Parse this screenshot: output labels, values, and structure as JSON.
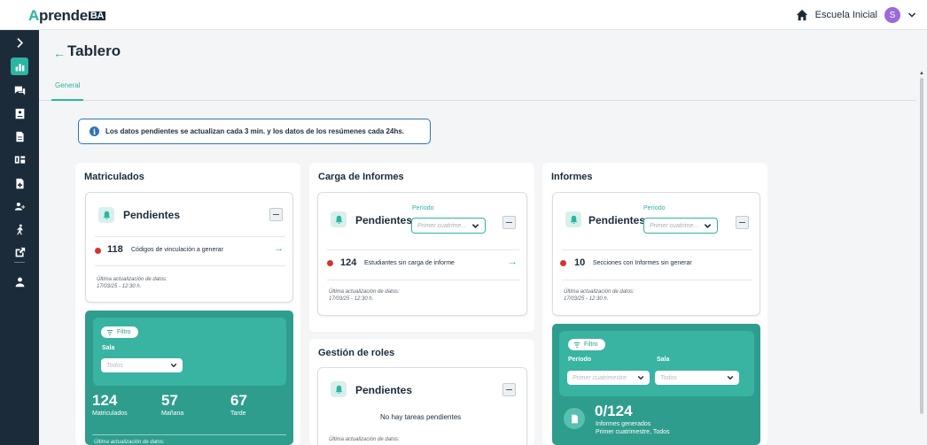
{
  "app": {
    "logo_prefix": "A",
    "logo_main": "prende",
    "logo_suffix": "BA"
  },
  "topbar": {
    "school": "Escuela Inicial",
    "avatar_initial": "S"
  },
  "header": {
    "title": "Tablero"
  },
  "tabs": [
    {
      "label": "General"
    }
  ],
  "banner": {
    "text": "Los datos pendientes se actualizan cada 3 min. y los datos de los resúmenes cada 24hs."
  },
  "matriculados": {
    "title": "Matriculados",
    "pendientes": {
      "title": "Pendientes",
      "count": "118",
      "label": "Códigos de vinculación a generar",
      "update_label": "Última actualización de datos:",
      "update_date": "17/03/25 - 12:30 h."
    },
    "summary": {
      "filter_label": "Filtro",
      "sala_label": "Sala",
      "sala_placeholder": "Todos",
      "stats": [
        {
          "value": "124",
          "label": "Matriculados"
        },
        {
          "value": "57",
          "label": "Mañana"
        },
        {
          "value": "67",
          "label": "Tarde"
        }
      ],
      "update_label": "Última actualización de datos:"
    }
  },
  "carga": {
    "title": "Carga de Informes",
    "pendientes": {
      "title": "Pendientes",
      "periodo_label": "Período",
      "periodo_placeholder": "Primer cuatrime...",
      "count": "124",
      "label": "Estudiantes sin carga de informe",
      "update_label": "Última actualización de datos:",
      "update_date": "17/03/25 - 12:30 h."
    }
  },
  "roles": {
    "title": "Gestión de roles",
    "pendientes": {
      "title": "Pendientes",
      "empty": "No hay tareas pendientes",
      "update_label": "Última actualización de datos:"
    }
  },
  "informes": {
    "title": "Informes",
    "pendientes": {
      "title": "Pendientes",
      "periodo_label": "Período",
      "periodo_placeholder": "Primer cuatrime...",
      "count": "10",
      "label": "Secciones con Informes sin generar",
      "update_label": "Última actualización de datos:",
      "update_date": "17/03/25 - 12:30 h."
    },
    "summary": {
      "filter_label": "Filtro",
      "periodo_label": "Período",
      "periodo_placeholder": "Primer cuatrimestre",
      "sala_label": "Sala",
      "sala_placeholder": "Todos",
      "fraction": "0/124",
      "generated_label": "Informes generados",
      "generated_detail": "Primer cuatrimestre, Todos"
    }
  },
  "colors": {
    "accent": "#2bb5a2",
    "sidebar": "#1b2b3a",
    "alert": "#d8322e",
    "info": "#2e74b5"
  }
}
